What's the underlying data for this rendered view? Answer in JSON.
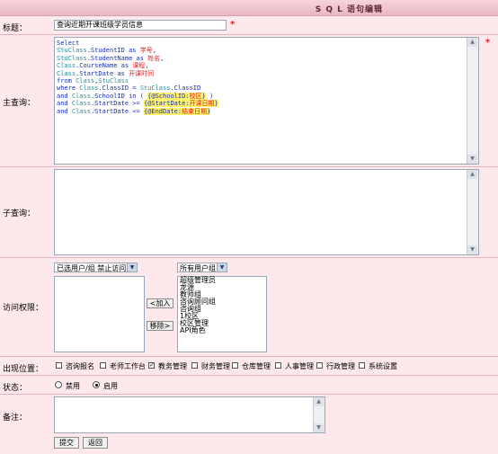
{
  "header": {
    "title": "S Q L 语句编辑"
  },
  "form": {
    "title_label": "标题：",
    "title_value": "查询近期开课班级学员信息",
    "required_mark": "*",
    "main_query_label": "主查询：",
    "sql_lines": [
      [
        {
          "t": "Select",
          "c": "kw"
        }
      ],
      [
        {
          "t": "StuClass",
          "c": "tb"
        },
        {
          "t": ".StudentID ",
          "c": "kw"
        },
        {
          "t": "as ",
          "c": "kw"
        },
        {
          "t": "学号",
          "c": "cn"
        },
        {
          "t": ",",
          "c": "kw"
        }
      ],
      [
        {
          "t": "StuClass",
          "c": "tb"
        },
        {
          "t": ".StudentName ",
          "c": "kw"
        },
        {
          "t": "as ",
          "c": "kw"
        },
        {
          "t": "姓名",
          "c": "cn"
        },
        {
          "t": ",",
          "c": "kw"
        }
      ],
      [
        {
          "t": "Class",
          "c": "tb"
        },
        {
          "t": ".CourseName ",
          "c": "kw"
        },
        {
          "t": "as ",
          "c": "kw"
        },
        {
          "t": "课程",
          "c": "cn"
        },
        {
          "t": ",",
          "c": "kw"
        }
      ],
      [
        {
          "t": "Class",
          "c": "tb"
        },
        {
          "t": ".StartDate ",
          "c": "kw"
        },
        {
          "t": "as ",
          "c": "kw"
        },
        {
          "t": "开课时间",
          "c": "cn"
        }
      ],
      [
        {
          "t": "from ",
          "c": "kw"
        },
        {
          "t": "Class",
          "c": "tb"
        },
        {
          "t": ",",
          "c": "kw"
        },
        {
          "t": "StuClass",
          "c": "tb"
        }
      ],
      [
        {
          "t": "where ",
          "c": "kw"
        },
        {
          "t": "Class",
          "c": "tb"
        },
        {
          "t": ".ClassID = ",
          "c": "kw"
        },
        {
          "t": "StuClass",
          "c": "tb"
        },
        {
          "t": ".ClassID",
          "c": "kw"
        }
      ],
      [
        {
          "t": "and ",
          "c": "kw"
        },
        {
          "t": "Class",
          "c": "tb"
        },
        {
          "t": ".SchoolID in ( ",
          "c": "kw"
        },
        {
          "t": "{@SchoolID:",
          "c": "pm"
        },
        {
          "t": "校区",
          "c": "pc"
        },
        {
          "t": "}",
          "c": "pm"
        },
        {
          "t": " )",
          "c": "kw"
        }
      ],
      [
        {
          "t": "and ",
          "c": "kw"
        },
        {
          "t": "Class",
          "c": "tb"
        },
        {
          "t": ".StartDate >= ",
          "c": "kw"
        },
        {
          "t": "{@StartDate:",
          "c": "pm"
        },
        {
          "t": "开课日期",
          "c": "pc"
        },
        {
          "t": "}",
          "c": "pm"
        }
      ],
      [
        {
          "t": "and ",
          "c": "kw"
        },
        {
          "t": "Class",
          "c": "tb"
        },
        {
          "t": ".StartDate <= ",
          "c": "kw"
        },
        {
          "t": "{@EndDate:",
          "c": "pm"
        },
        {
          "t": "结束日期",
          "c": "pc"
        },
        {
          "t": "}",
          "c": "pm"
        }
      ]
    ],
    "sub_query_label": "子查询：",
    "access_label": "访问权限：",
    "left_select": "已选用户/组 禁止访问",
    "right_select": "所有用户组",
    "add_button": "<加入",
    "remove_button": "移除>",
    "groups": [
      "超级管理员",
      "龙源",
      "教师组",
      "咨询顾问组",
      "咨询组",
      "1校区",
      "校区管理",
      "API角色"
    ],
    "position_label": "出现位置：",
    "positions": [
      {
        "label": "咨询报名",
        "checked": false
      },
      {
        "label": "老师工作台",
        "checked": false
      },
      {
        "label": "教务管理",
        "checked": true
      },
      {
        "label": "财务管理",
        "checked": false
      },
      {
        "label": "仓库管理",
        "checked": false
      },
      {
        "label": "人事管理",
        "checked": false
      },
      {
        "label": "行政管理",
        "checked": false
      },
      {
        "label": "系统设置",
        "checked": false
      }
    ],
    "status_label": "状态：",
    "status_disable": "禁用",
    "status_enable": "启用",
    "status_value": "启用",
    "note_label": "备注：",
    "submit_button": "提交",
    "back_button": "返回"
  }
}
